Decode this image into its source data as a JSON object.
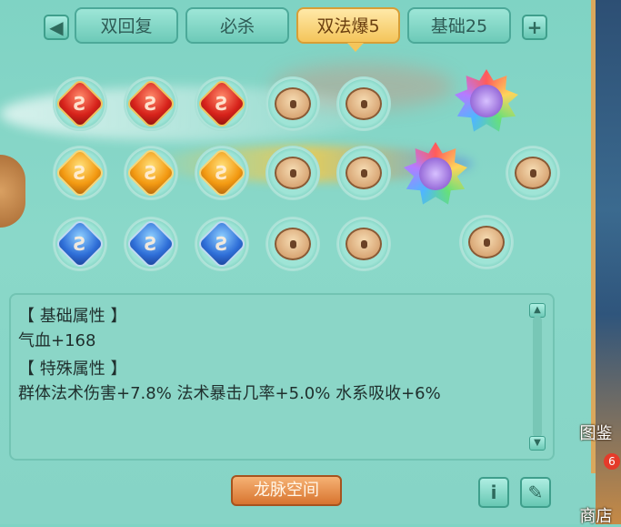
{
  "tabs": [
    {
      "label": "双回复",
      "active": false
    },
    {
      "label": "必杀",
      "active": false
    },
    {
      "label": "双法爆5",
      "active": true
    },
    {
      "label": "基础25",
      "active": false
    }
  ],
  "icons": {
    "prev": "left-arrow-icon",
    "add": "plus-icon",
    "info": "info-icon",
    "edit": "edit-icon"
  },
  "gems": {
    "rows": [
      [
        "red",
        "red",
        "red",
        "locked-special",
        "locked"
      ],
      [
        "orange",
        "orange",
        "orange",
        "locked",
        "locked"
      ],
      [
        "blue",
        "blue",
        "blue",
        "locked",
        "locked"
      ]
    ],
    "special_slots": [
      "star",
      "star",
      "locked",
      "locked"
    ]
  },
  "panel": {
    "basic_header": "【 基础属性 】",
    "basic_value": "气血+168",
    "special_header": "【 特殊属性 】",
    "special_value": "群体法术伤害+7.8%  法术暴击几率+5.0%  水系吸收+6%"
  },
  "bottom_button": "龙脉空间",
  "right_menu": {
    "guide": "图鉴",
    "shop": "商店",
    "shop_badge": "6"
  }
}
